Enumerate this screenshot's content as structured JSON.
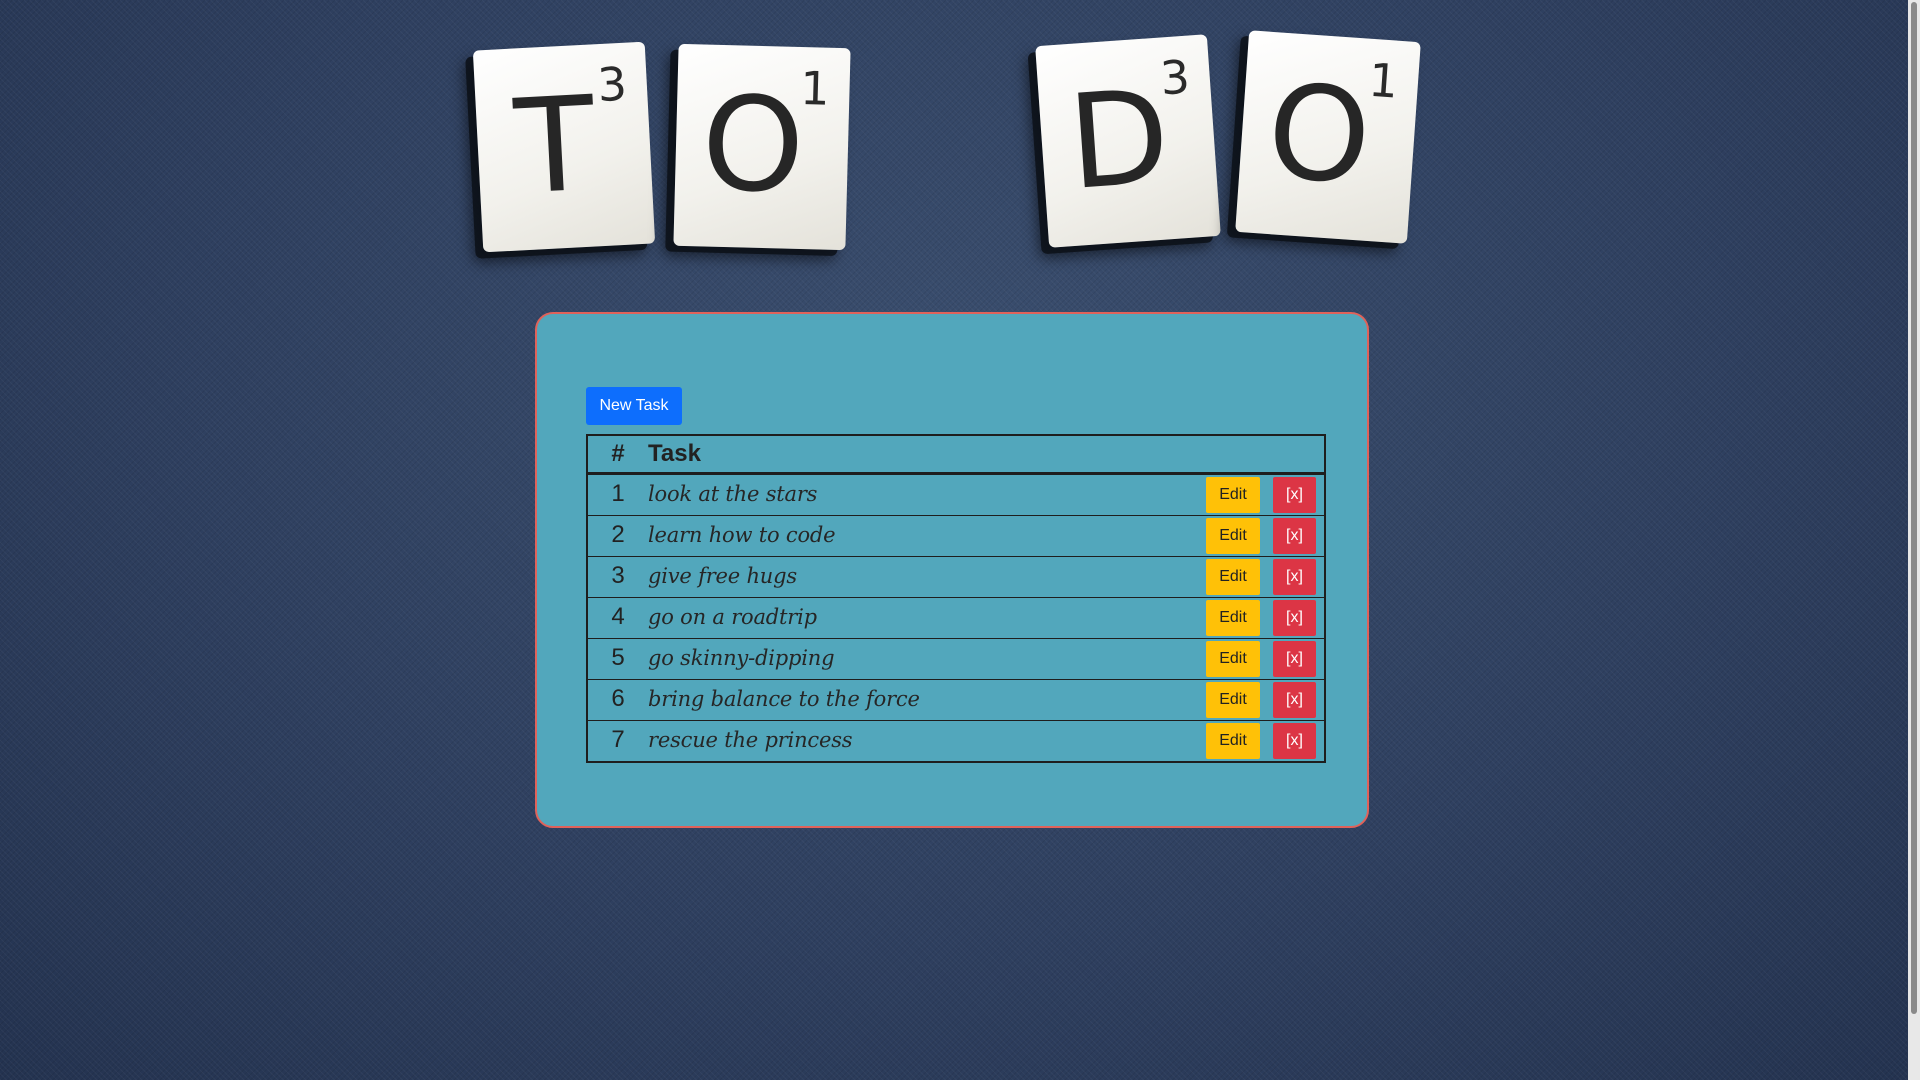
{
  "header": {
    "tiles": [
      {
        "letter": "T",
        "score": "3"
      },
      {
        "letter": "O",
        "score": "1"
      },
      {
        "letter": "D",
        "score": "3"
      },
      {
        "letter": "O",
        "score": "1"
      }
    ]
  },
  "toolbar": {
    "new_task_label": "New Task"
  },
  "table": {
    "headers": {
      "num": "#",
      "task": "Task"
    },
    "edit_label": "Edit",
    "delete_label": "[x]",
    "rows": [
      {
        "num": "1",
        "task": "look at the stars"
      },
      {
        "num": "2",
        "task": "learn how to code"
      },
      {
        "num": "3",
        "task": "give free hugs"
      },
      {
        "num": "4",
        "task": "go on a roadtrip"
      },
      {
        "num": "5",
        "task": "go skinny-dipping"
      },
      {
        "num": "6",
        "task": "bring balance to the force"
      },
      {
        "num": "7",
        "task": "rescue the princess"
      }
    ]
  },
  "colors": {
    "card_bg": "#52a7bc",
    "card_border": "#e0625a",
    "primary": "#0d6efd",
    "warning": "#ffc107",
    "danger": "#dc3545"
  }
}
